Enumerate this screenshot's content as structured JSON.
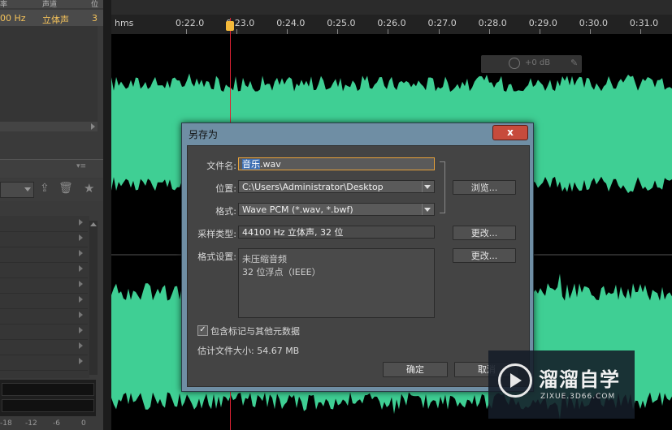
{
  "files_panel": {
    "headers": [
      "率",
      "声道",
      "位"
    ],
    "row": {
      "rate": "00 Hz",
      "channels": "立体声",
      "bits": "3"
    }
  },
  "timeline": {
    "unit": "hms",
    "ticks": [
      "0:22.0",
      "0:23.0",
      "0:24.0",
      "0:25.0",
      "0:26.0",
      "0:27.0",
      "0:28.0",
      "0:29.0",
      "0:30.0",
      "0:31.0"
    ],
    "volume": "+0 dB"
  },
  "meter_scale": [
    "-18",
    "-12",
    "-6",
    "0"
  ],
  "dialog": {
    "title": "另存为",
    "close": "x",
    "filename_label": "文件名:",
    "filename_selected": "音乐",
    "filename_ext": ".wav",
    "location_label": "位置:",
    "location_value": "C:\\Users\\Administrator\\Desktop",
    "browse_button": "浏览...",
    "format_label": "格式:",
    "format_value": "Wave PCM (*.wav, *.bwf)",
    "sample_label": "采样类型:",
    "sample_value": "44100 Hz 立体声, 32 位",
    "change_button_1": "更改...",
    "settings_label": "格式设置:",
    "settings_line1": "未压缩音频",
    "settings_line2": "32 位浮点（IEEE）",
    "change_button_2": "更改...",
    "checkbox_label": "包含标记与其他元数据",
    "checkbox_checked": true,
    "size_label": "估计文件大小: 54.67 MB",
    "ok_button": "确定",
    "cancel_button": "取消"
  },
  "watermark": {
    "name": "溜溜自学",
    "url": "ZIXUE.3D66.COM"
  },
  "colors": {
    "waveform": "#3fcf94",
    "panel": "#444444",
    "titlebar": "#6f8ea4",
    "playhead": "#dd2233"
  }
}
